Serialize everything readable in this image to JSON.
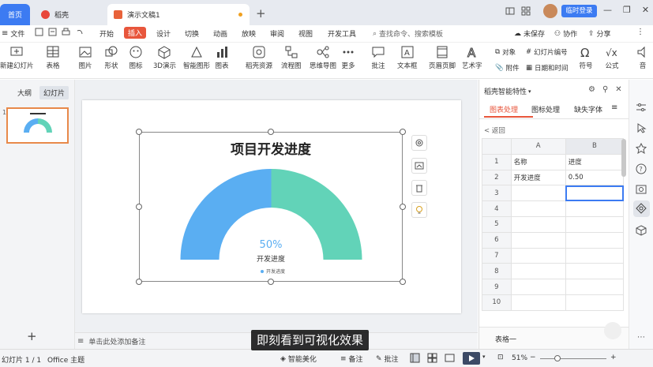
{
  "tabs": {
    "home": "首页",
    "daoke": "稻壳",
    "doc": "演示文稿1",
    "login": "临时登录"
  },
  "menu": {
    "file": "文件",
    "items": [
      "开始",
      "插入",
      "设计",
      "切换",
      "动画",
      "放映",
      "审阅",
      "视图",
      "开发工具"
    ],
    "active": "插入",
    "search": "查找命令、搜索模板",
    "unsaved": "未保存",
    "collab": "协作",
    "share": "分享"
  },
  "toolbar": {
    "new_slide": "新建幻灯片",
    "table": "表格",
    "picture": "图片",
    "shape": "形状",
    "icon": "图标",
    "threed": "3D演示",
    "smart": "智能图形",
    "chart": "图表",
    "daoke_res": "稻壳资源",
    "flow": "流程图",
    "mind": "思维导图",
    "more": "更多",
    "comment": "批注",
    "textbox": "文本框",
    "header_footer": "页眉页脚",
    "art": "艺术字",
    "object": "对象",
    "attach": "附件",
    "slide_no": "幻灯片编号",
    "datetime": "日期和时间",
    "symbol": "符号",
    "formula": "公式",
    "audio": "音"
  },
  "left": {
    "outline": "大纲",
    "slides": "幻灯片",
    "slide_num": "1",
    "add": "+"
  },
  "slide": {
    "title": "项目开发进度",
    "percent": "50%",
    "label": "开发进度",
    "legend": "开发进度"
  },
  "chart_data": {
    "type": "pie",
    "title": "项目开发进度",
    "categories": [
      "开发进度"
    ],
    "values": [
      0.5
    ],
    "colors": [
      "#5aaef2",
      "#62d3b8"
    ]
  },
  "right_panel": {
    "title": "稻壳智能特性",
    "tabs": [
      "图表处理",
      "图标处理",
      "缺失字体"
    ],
    "back": "< 返回",
    "columns": [
      "A",
      "B"
    ],
    "rows": [
      [
        "名称",
        "进度"
      ],
      [
        "开发进度",
        "0.50"
      ],
      [
        "",
        ""
      ],
      [
        "",
        ""
      ],
      [
        "",
        ""
      ],
      [
        "",
        ""
      ],
      [
        "",
        ""
      ],
      [
        "",
        ""
      ],
      [
        "",
        ""
      ],
      [
        "",
        ""
      ]
    ],
    "sheet": "表格一"
  },
  "notes": {
    "placeholder": "单击此处添加备注"
  },
  "status": {
    "slide": "幻灯片 1 / 1",
    "theme": "Office 主题",
    "beautify": "智能美化",
    "notes": "备注",
    "comment": "批注",
    "zoom": "51%"
  },
  "subtitle": "即刻看到可视化效果"
}
